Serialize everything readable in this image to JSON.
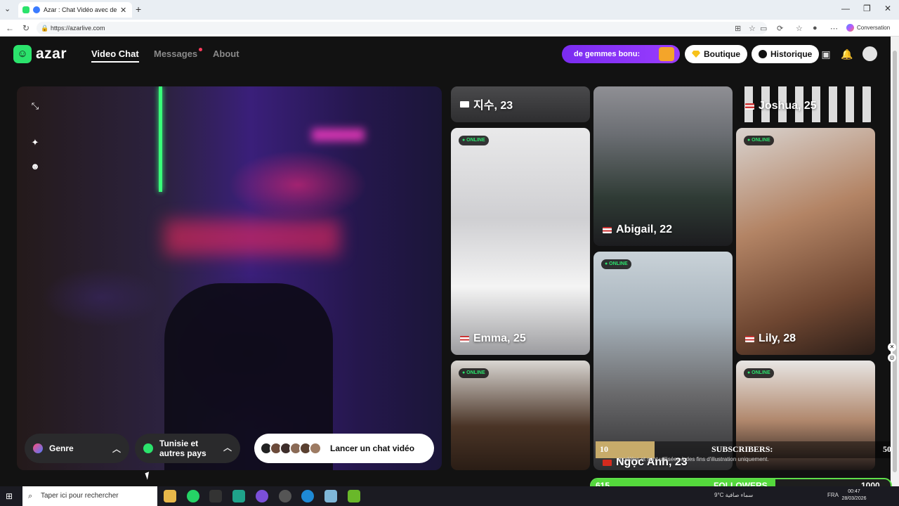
{
  "browser": {
    "tab_title": "Azar : Chat Vidéo avec de nou",
    "url": "https://azarlive.com",
    "conversation_label": "Conversation"
  },
  "header": {
    "logo_text": "azar",
    "nav": [
      {
        "label": "Video Chat"
      },
      {
        "label": "Messages"
      },
      {
        "label": "About"
      }
    ],
    "promo_label": "de gemmes bonu:",
    "boutique_label": "Boutique",
    "historique_label": "Historique"
  },
  "controls": {
    "gender_label": "Genre",
    "region_label_line1": "Tunisie et",
    "region_label_line2": "autres pays",
    "launch_label": "Lancer un chat vidéo"
  },
  "profiles": [
    {
      "name": "지수, 23",
      "online": ""
    },
    {
      "name": "Emma, 25",
      "online": "ONLINE"
    },
    {
      "name": "",
      "online": "ONLINE"
    },
    {
      "name": "Abigail, 22",
      "online": ""
    },
    {
      "name": "Ngọc Anh, 23",
      "online": "ONLINE"
    },
    {
      "name": "Joshua, 25",
      "online": ""
    },
    {
      "name": "Lily, 28",
      "online": "ONLINE"
    },
    {
      "name": "",
      "online": "ONLINE"
    }
  ],
  "overlays": {
    "sub_count": "10",
    "sub_label": "SUBSCRIBERS:",
    "sub_goal": "50",
    "sub_progress": 0.2,
    "fine_print": "modèles et sont utilisées à des fins d'illustration uniquement.",
    "followers_count": "615",
    "followers_label": "FOLLOWERS",
    "followers_goal": "1000",
    "followers_progress": 0.615
  },
  "taskbar": {
    "search_placeholder": "Taper ici pour rechercher",
    "weather": "9°C  سماء صافية",
    "lang": "FRA",
    "time": "00:47",
    "date": "28/03/2026"
  }
}
